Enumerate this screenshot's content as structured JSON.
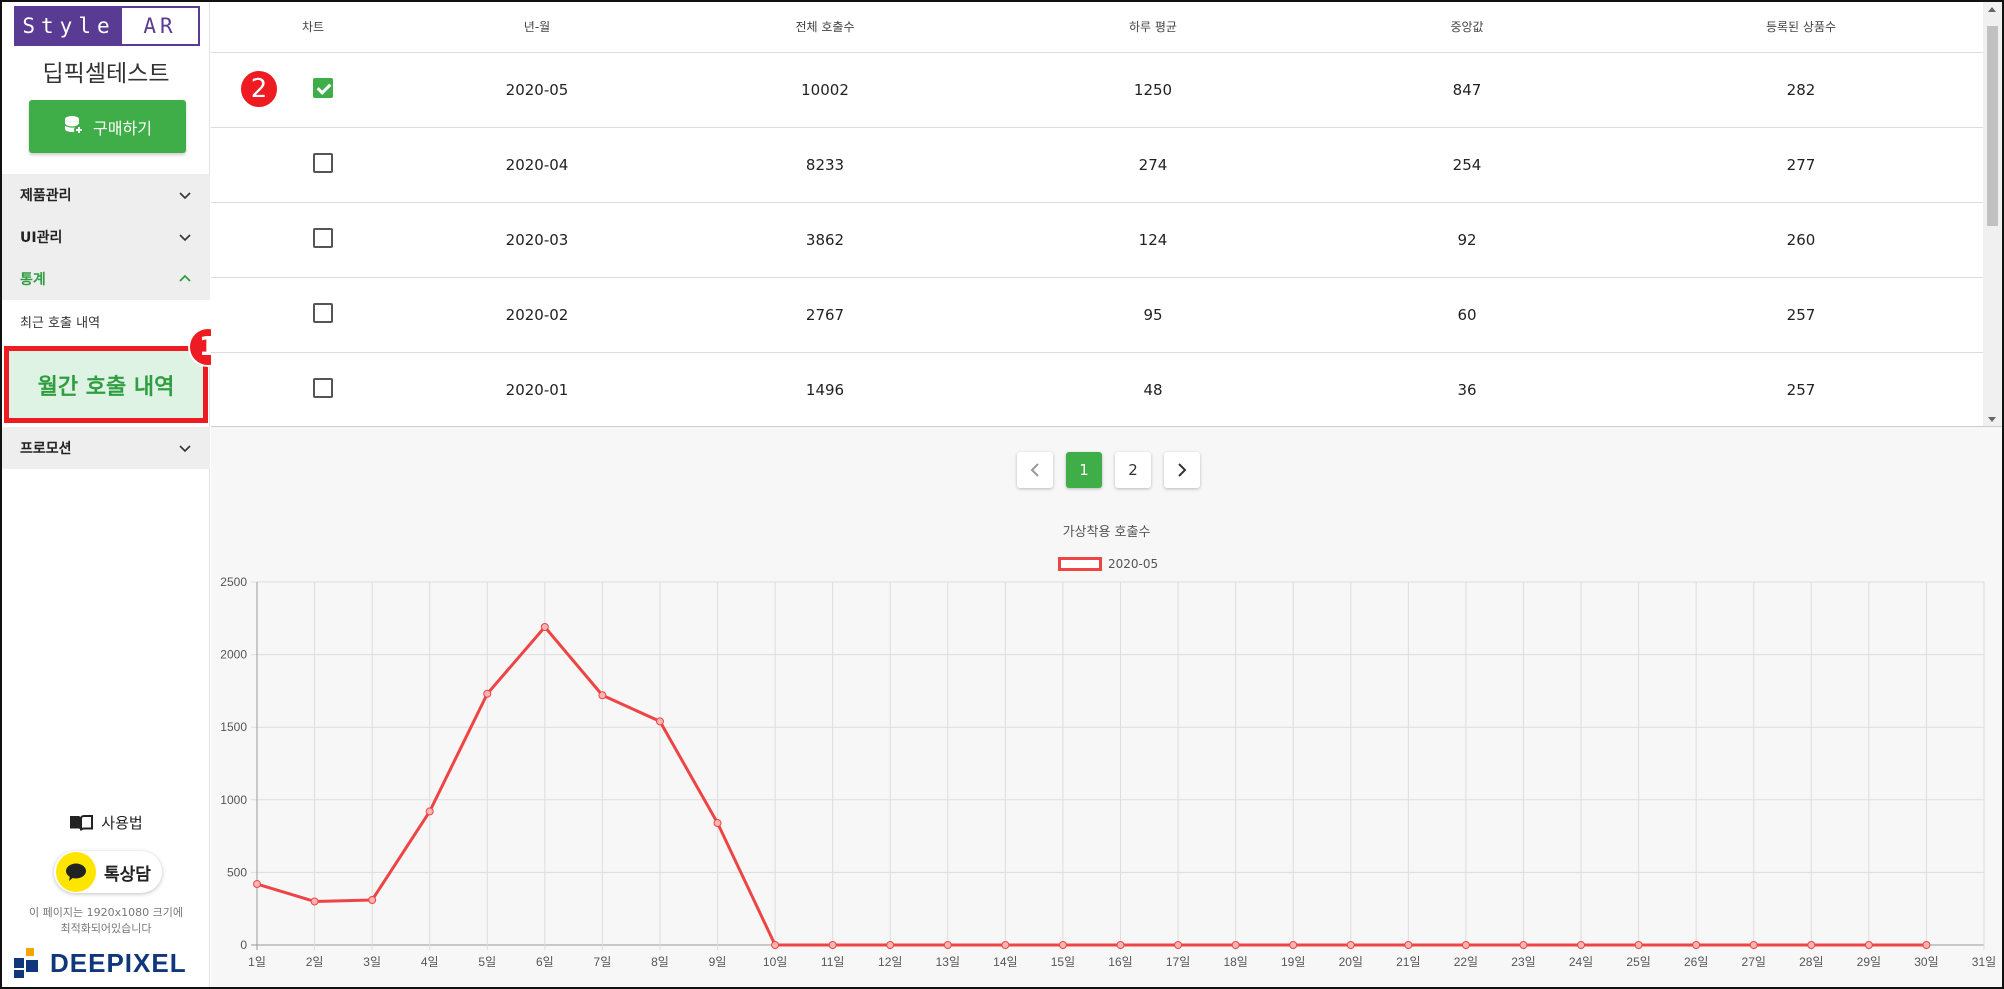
{
  "sidebar": {
    "logo_left": "Style",
    "logo_right": "AR",
    "company": "딥픽셀테스트",
    "buy_label": "구매하기",
    "menu": [
      {
        "label": "제품관리",
        "state": "collapsed"
      },
      {
        "label": "UI관리",
        "state": "collapsed"
      },
      {
        "label": "통계",
        "state": "expanded"
      }
    ],
    "submenu": {
      "recent": "최근 호출 내역",
      "monthly": "월간 호출 내역"
    },
    "promotion": "프로모션",
    "usage": "사용법",
    "kakao": "톡상담",
    "note_line1": "이 페이지는 1920x1080 크기에",
    "note_line2": "최적화되어있습니다",
    "brand": "DEEPIXEL"
  },
  "markers": {
    "m1": "1",
    "m2": "2"
  },
  "table": {
    "headers": [
      "차트",
      "년-월",
      "전체 호출수",
      "하루 평균",
      "중앙값",
      "등록된 상품수"
    ],
    "rows": [
      {
        "checked": true,
        "month": "2020-05",
        "total": "10002",
        "avg": "1250",
        "median": "847",
        "products": "282"
      },
      {
        "checked": false,
        "month": "2020-04",
        "total": "8233",
        "avg": "274",
        "median": "254",
        "products": "277"
      },
      {
        "checked": false,
        "month": "2020-03",
        "total": "3862",
        "avg": "124",
        "median": "92",
        "products": "260"
      },
      {
        "checked": false,
        "month": "2020-02",
        "total": "2767",
        "avg": "95",
        "median": "60",
        "products": "257"
      },
      {
        "checked": false,
        "month": "2020-01",
        "total": "1496",
        "avg": "48",
        "median": "36",
        "products": "257"
      }
    ]
  },
  "pagination": {
    "pages": [
      "1",
      "2"
    ],
    "current": "1"
  },
  "colors": {
    "accent": "#3fae49",
    "brand": "#5a3b93",
    "highlight": "#ee1b22",
    "series": "#ee4444"
  },
  "chart_data": {
    "type": "line",
    "title": "가상착용 호출수",
    "series": [
      {
        "name": "2020-05",
        "values": [
          420,
          300,
          310,
          920,
          1730,
          2190,
          1720,
          1540,
          840,
          0,
          0,
          0,
          0,
          0,
          0,
          0,
          0,
          0,
          0,
          0,
          0,
          0,
          0,
          0,
          0,
          0,
          0,
          0,
          0,
          0
        ]
      }
    ],
    "categories": [
      "1일",
      "2일",
      "3일",
      "4일",
      "5일",
      "6일",
      "7일",
      "8일",
      "9일",
      "10일",
      "11일",
      "12일",
      "13일",
      "14일",
      "15일",
      "16일",
      "17일",
      "18일",
      "19일",
      "20일",
      "21일",
      "22일",
      "23일",
      "24일",
      "25일",
      "26일",
      "27일",
      "28일",
      "29일",
      "30일",
      "31일"
    ],
    "ylim": [
      0,
      2500
    ],
    "yticks": [
      0,
      500,
      1000,
      1500,
      2000,
      2500
    ],
    "grid": true,
    "legend": "top-center"
  }
}
